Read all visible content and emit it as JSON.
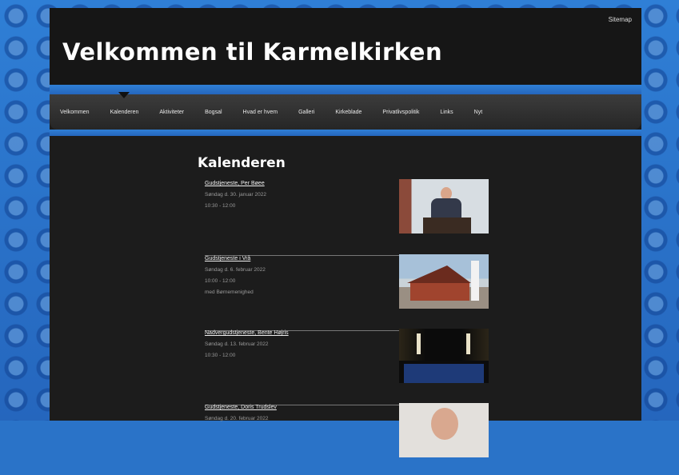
{
  "header": {
    "sitemap_label": "Sitemap",
    "site_title": "Velkommen til Karmelkirken"
  },
  "nav": {
    "items": [
      "Velkommen",
      "Kalenderen",
      "Aktiviteter",
      "Bogsal",
      "Hvad er hvem",
      "Galleri",
      "Kirkeblade",
      "Privatlivspolitik",
      "Links",
      "Nyt"
    ],
    "active_index": 1
  },
  "main": {
    "heading": "Kalenderen",
    "events": [
      {
        "title": "Gudstjeneste, Per Bøee",
        "date": "Søndag d. 30. januar 2022",
        "time": "10:30 - 12:00",
        "note": "",
        "photo_icon": "person-at-lectern-photo"
      },
      {
        "title": "Gudstjeneste i Vrå",
        "date": "Søndag d. 6. februar 2022",
        "time": "10:00 - 12:00",
        "note": "med Børnemenighed",
        "photo_icon": "church-building-photo"
      },
      {
        "title": "Nadvergudstjeneste, Bente Højris",
        "date": "Søndag d. 13. februar 2022",
        "time": "10:30 - 12:00",
        "note": "",
        "photo_icon": "altar-candles-photo"
      },
      {
        "title": "Gudstjeneste, Doris Trudslev",
        "date": "Søndag d. 20. februar 2022",
        "time": "",
        "note": "",
        "photo_icon": "person-portrait-photo"
      }
    ]
  },
  "colors": {
    "page_background": "#2a73c8",
    "frame": "#1c1c1c",
    "nav": "#2f2f2f",
    "text": "#ffffff"
  }
}
